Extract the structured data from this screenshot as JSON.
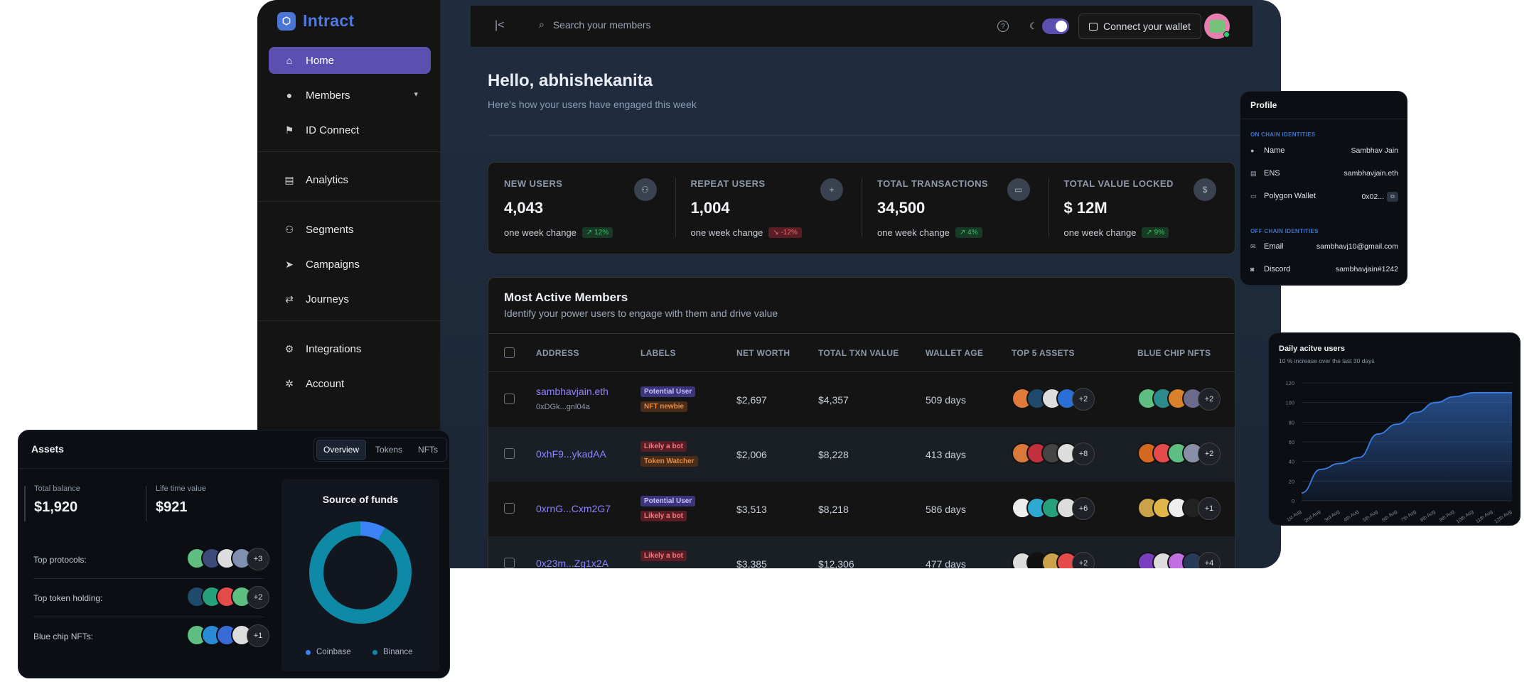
{
  "app": {
    "brand": "Intract",
    "nav": {
      "home": "Home",
      "members": "Members",
      "id_connect": "ID Connect",
      "analytics": "Analytics",
      "segments": "Segments",
      "campaigns": "Campaigns",
      "journeys": "Journeys",
      "integrations": "Integrations",
      "account": "Account"
    },
    "topbar": {
      "search_placeholder": "Search your members",
      "wallet_button": "Connect your wallet"
    },
    "greeting": "Hello, abhishekanita",
    "subgreeting": "Here's how your users have engaged this week",
    "stats": [
      {
        "label": "NEW USERS",
        "value": "4,043",
        "change_label": "one week change",
        "delta": "12%",
        "trend": "up"
      },
      {
        "label": "REPEAT USERS",
        "value": "1,004",
        "change_label": "one week change",
        "delta": "-12%",
        "trend": "down"
      },
      {
        "label": "TOTAL TRANSACTIONS",
        "value": "34,500",
        "change_label": "one week change",
        "delta": "4%",
        "trend": "up"
      },
      {
        "label": "TOTAL VALUE LOCKED",
        "value": "$ 12M",
        "change_label": "one week change",
        "delta": "9%",
        "trend": "up"
      }
    ],
    "members": {
      "title": "Most Active Members",
      "subtitle": "Identify your power users to engage with them and drive value",
      "columns": [
        "ADDRESS",
        "LABELS",
        "NET WORTH",
        "TOTAL TXN VALUE",
        "WALLET AGE",
        "TOP 5 ASSETS",
        "BLUE CHIP NFTS"
      ],
      "rows": [
        {
          "address": "sambhavjain.eth",
          "sub": "0xDGk...gnl04a",
          "labels": [
            "Potential User",
            "NFT newbie"
          ],
          "net_worth": "$2,697",
          "txn_value": "$4,357",
          "wallet_age": "509 days",
          "assets_more": "+2",
          "nfts_more": "+2"
        },
        {
          "address": "0xhF9...ykadAA",
          "sub": "",
          "labels": [
            "Likely a bot",
            "Token Watcher"
          ],
          "net_worth": "$2,006",
          "txn_value": "$8,228",
          "wallet_age": "413 days",
          "assets_more": "+8",
          "nfts_more": "+2"
        },
        {
          "address": "0xrnG...Cxm2G7",
          "sub": "",
          "labels": [
            "Potential User",
            "Likely a bot"
          ],
          "net_worth": "$3,513",
          "txn_value": "$8,218",
          "wallet_age": "586 days",
          "assets_more": "+6",
          "nfts_more": "+1"
        },
        {
          "address": "0x23m...Zg1x2A",
          "sub": "",
          "labels": [
            "Likely a bot"
          ],
          "net_worth": "$3,385",
          "txn_value": "$12,306",
          "wallet_age": "477 days",
          "assets_more": "+2",
          "nfts_more": "+4"
        }
      ]
    }
  },
  "profile": {
    "title": "Profile",
    "on_chain_heading": "ON CHAIN IDENTITIES",
    "off_chain_heading": "OFF CHAIN IDENTITIES",
    "on_chain": [
      {
        "key": "Name",
        "value": "Sambhav Jain"
      },
      {
        "key": "ENS",
        "value": "sambhavjain.eth"
      },
      {
        "key": "Polygon Wallet",
        "value": "0x02..."
      }
    ],
    "off_chain": [
      {
        "key": "Email",
        "value": "sambhavj10@gmail.com"
      },
      {
        "key": "Discord",
        "value": "sambhavjain#1242"
      }
    ]
  },
  "dau": {
    "title": "Daily acitve users",
    "subtitle": "10 % increase over the last 30 days"
  },
  "chart_data": {
    "type": "area",
    "title": "Daily acitve users",
    "x": [
      "1st Aug",
      "2nd Aug",
      "3rd Aug",
      "4th Aug",
      "5th Aug",
      "6th Aug",
      "7th Aug",
      "8th Aug",
      "9th Aug",
      "10th Aug",
      "11th Aug",
      "12th Aug"
    ],
    "series": [
      {
        "values": [
          8,
          32,
          38,
          44,
          68,
          78,
          90,
          100,
          106,
          110,
          110,
          110
        ]
      }
    ],
    "ylim": [
      0,
      120
    ],
    "yticks": [
      0,
      20,
      40,
      60,
      80,
      100,
      120
    ],
    "color": "#3b7fe6",
    "grid": true
  },
  "assets": {
    "title": "Assets",
    "tabs": [
      "Overview",
      "Tokens",
      "NFTs"
    ],
    "total_balance_label": "Total balance",
    "total_balance": "$1,920",
    "lifetime_label": "Life time value",
    "lifetime_value": "$921",
    "rows": [
      {
        "label": "Top protocols:",
        "more": "+3"
      },
      {
        "label": "Top token holding:",
        "more": "+2"
      },
      {
        "label": "Blue chip NFTs:",
        "more": "+1"
      }
    ],
    "source_of_funds": {
      "title": "Source of funds",
      "slices": [
        {
          "name": "Coinbase",
          "value": 8,
          "color": "#3b82f6"
        },
        {
          "name": "Binance",
          "value": 92,
          "color": "#0e8aa6"
        }
      ]
    }
  }
}
